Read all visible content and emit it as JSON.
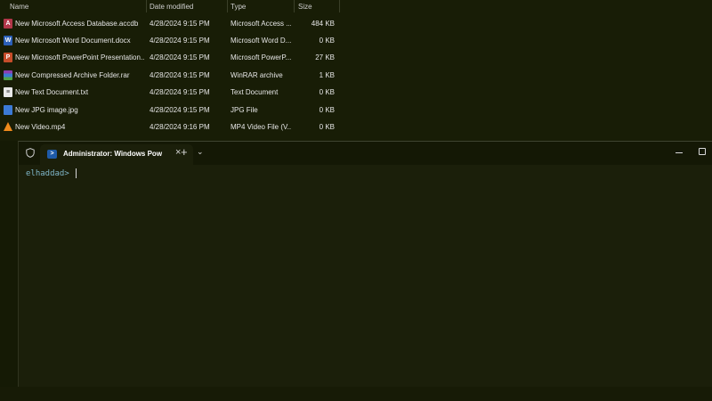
{
  "explorer": {
    "columns": {
      "name": "Name",
      "date": "Date modified",
      "type": "Type",
      "size": "Size"
    },
    "files": [
      {
        "name": "New Microsoft Access Database.accdb",
        "date": "4/28/2024 9:15 PM",
        "type": "Microsoft Access ...",
        "size": "484 KB",
        "icon": "access-file-icon"
      },
      {
        "name": "New Microsoft Word Document.docx",
        "date": "4/28/2024 9:15 PM",
        "type": "Microsoft Word D...",
        "size": "0 KB",
        "icon": "word-file-icon"
      },
      {
        "name": "New Microsoft PowerPoint Presentation....",
        "date": "4/28/2024 9:15 PM",
        "type": "Microsoft PowerP...",
        "size": "27 KB",
        "icon": "powerpoint-file-icon"
      },
      {
        "name": "New Compressed Archive Folder.rar",
        "date": "4/28/2024 9:15 PM",
        "type": "WinRAR archive",
        "size": "1 KB",
        "icon": "rar-archive-icon"
      },
      {
        "name": "New Text Document.txt",
        "date": "4/28/2024 9:15 PM",
        "type": "Text Document",
        "size": "0 KB",
        "icon": "text-file-icon"
      },
      {
        "name": "New JPG image.jpg",
        "date": "4/28/2024 9:15 PM",
        "type": "JPG File",
        "size": "0 KB",
        "icon": "jpg-file-icon"
      },
      {
        "name": "New Video.mp4",
        "date": "4/28/2024 9:16 PM",
        "type": "MP4 Video File (V...",
        "size": "0 KB",
        "icon": "vlc-video-icon"
      }
    ]
  },
  "terminal": {
    "tab_title": "Administrator: Windows Pow",
    "tab_close": "×",
    "new_tab": "+",
    "dropdown": "⌄",
    "prompt": "elhaddad>"
  },
  "colors": {
    "background": "#151a05",
    "prompt": "#7fb6c9"
  }
}
